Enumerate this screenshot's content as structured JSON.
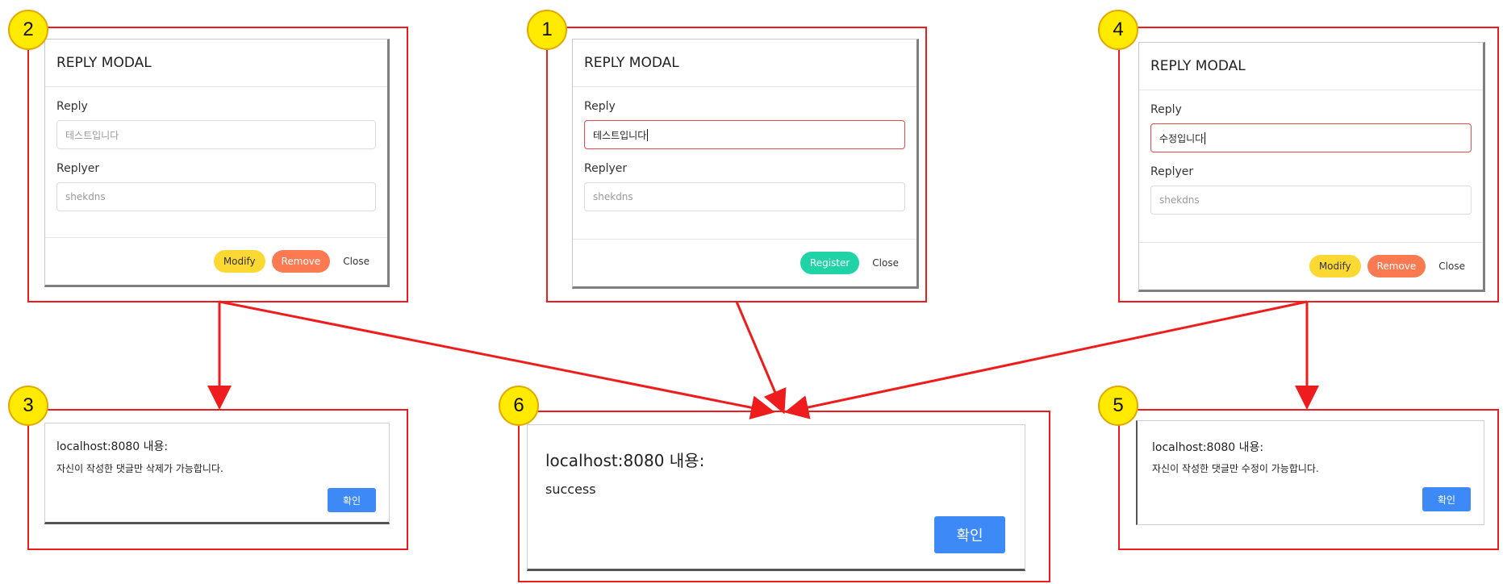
{
  "steps": [
    "1",
    "2",
    "3",
    "4",
    "5",
    "6"
  ],
  "modal": {
    "title": "REPLY MODAL",
    "reply_label": "Reply",
    "replyer_label": "Replyer",
    "close_label": "Close",
    "modify_label": "Modify",
    "remove_label": "Remove",
    "register_label": "Register"
  },
  "modal_step2": {
    "reply_value": "테스트입니다",
    "replyer_value": "shekdns"
  },
  "modal_step1": {
    "reply_value": "테스트입니다",
    "replyer_value": "shekdns"
  },
  "modal_step4": {
    "reply_value": "수정입니다",
    "replyer_value": "shekdns"
  },
  "alert": {
    "title": "localhost:8080 내용:",
    "ok_label": "확인",
    "step3_message": "자신이 작성한 댓글만 삭제가 가능합니다.",
    "step5_message": "자신이 작성한 댓글만 수정이 가능합니다.",
    "step6_message": "success"
  },
  "colors": {
    "annotation_red": "#ee1c1c",
    "badge_yellow": "#ffea00",
    "modify_yellow": "#fcd932",
    "remove_orange": "#fb7a52",
    "register_green": "#1fd3a6",
    "ok_blue": "#3d8af7"
  }
}
